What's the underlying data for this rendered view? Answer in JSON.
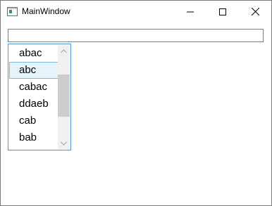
{
  "window": {
    "title": "MainWindow",
    "icon": "app-window-icon",
    "controls": [
      "minimize-icon",
      "maximize-icon",
      "close-icon"
    ]
  },
  "textbox": {
    "value": ""
  },
  "listbox": {
    "items": [
      "abac",
      "abc",
      "cabac",
      "ddaeb",
      "cab",
      "bab"
    ],
    "selected_index": 1,
    "scroll_position_fraction": 0.47,
    "visible_fraction": 0.53
  },
  "colors": {
    "focus_border": "#3b8fd6",
    "selection_fill": "#e5f3fb",
    "selection_border": "#7eb4ea",
    "scrollbar_thumb": "#cdcdcd"
  }
}
